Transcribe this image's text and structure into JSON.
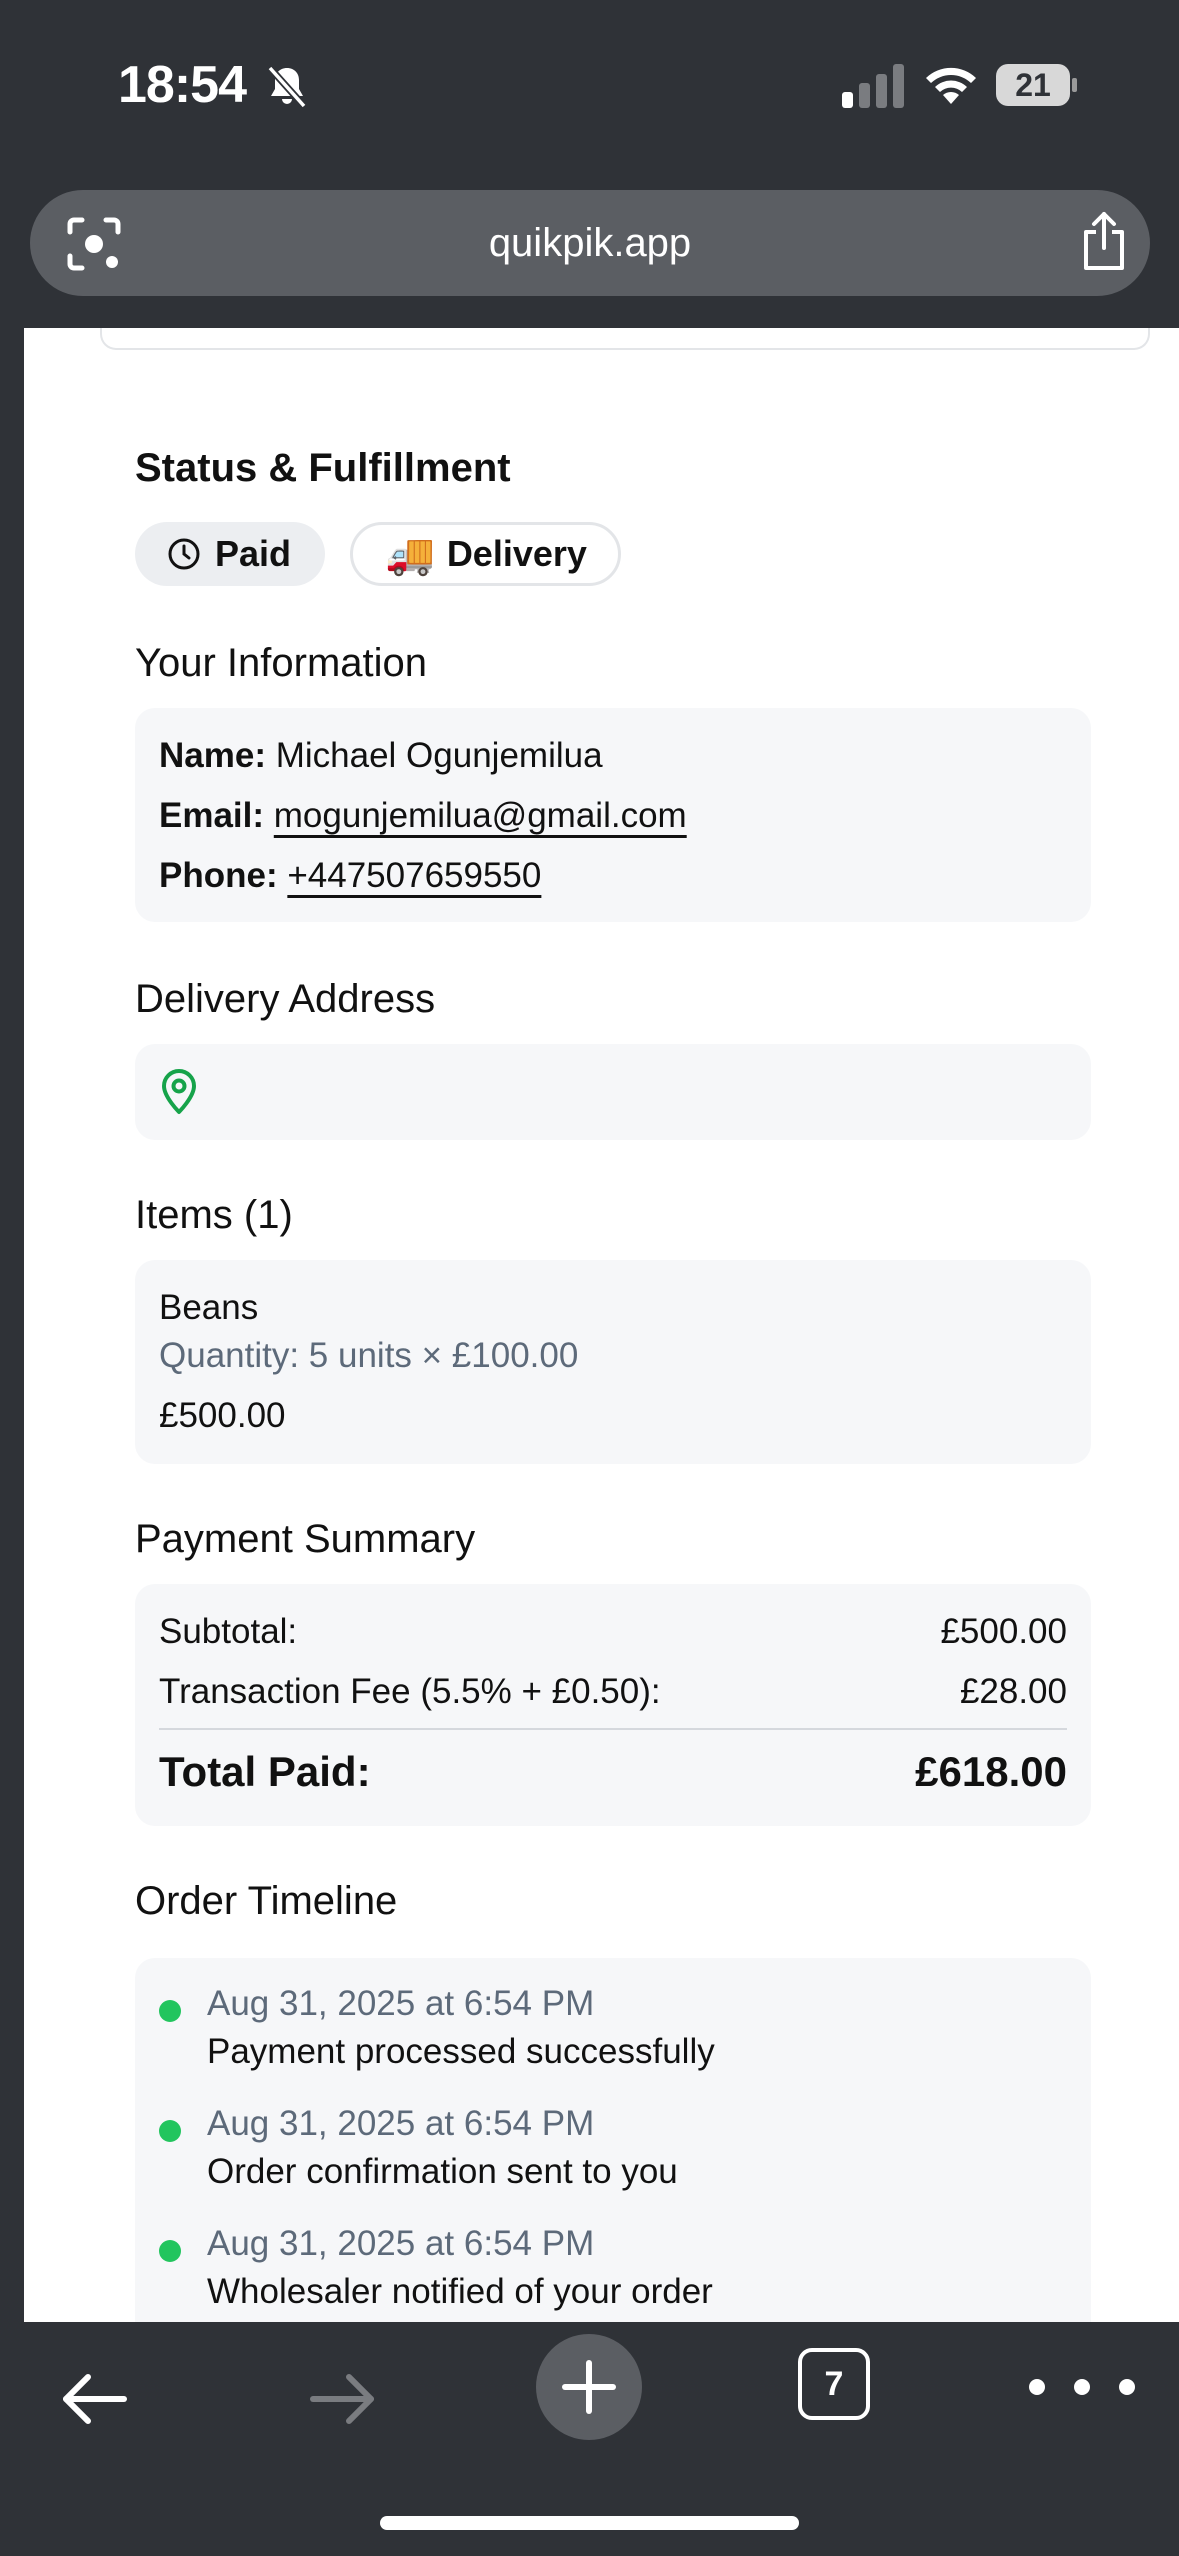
{
  "status_bar": {
    "time": "18:54",
    "battery": "21",
    "icons": [
      "bell-slash-icon",
      "signal-icon",
      "wifi-icon",
      "battery-icon"
    ]
  },
  "browser": {
    "url": "quikpik.app",
    "tab_count": "7"
  },
  "status_section": {
    "title": "Status & Fulfillment",
    "paid_label": "Paid",
    "delivery_emoji": "🚚",
    "delivery_label": "Delivery"
  },
  "info_section": {
    "title": "Your Information",
    "name_label": "Name:",
    "name_value": "Michael Ogunjemilua",
    "email_label": "Email:",
    "email_value": "mogunjemilua@gmail.com",
    "phone_label": "Phone:",
    "phone_value": "+447507659550"
  },
  "address_section": {
    "title": "Delivery Address"
  },
  "items_section": {
    "title": "Items (1)",
    "items": [
      {
        "name": "Beans",
        "quantity": "Quantity: 5 units × £100.00",
        "price": "£500.00"
      }
    ]
  },
  "payment_section": {
    "title": "Payment Summary",
    "subtotal_label": "Subtotal:",
    "subtotal_value": "£500.00",
    "fee_label": "Transaction Fee (5.5% + £0.50):",
    "fee_value": "£28.00",
    "total_label": "Total Paid:",
    "total_value": "£618.00"
  },
  "timeline_section": {
    "title": "Order Timeline",
    "events": [
      {
        "date": "Aug 31, 2025 at 6:54 PM",
        "text": "Payment processed successfully"
      },
      {
        "date": "Aug 31, 2025 at 6:54 PM",
        "text": "Order confirmation sent to you"
      },
      {
        "date": "Aug 31, 2025 at 6:54 PM",
        "text": "Wholesaler notified of your order"
      }
    ]
  },
  "colors": {
    "chrome": "#2f3237",
    "url_bar": "#5b5e63",
    "card_bg": "#f6f7f9",
    "success_green": "#22c55e",
    "muted_text": "#5d6a7a"
  }
}
